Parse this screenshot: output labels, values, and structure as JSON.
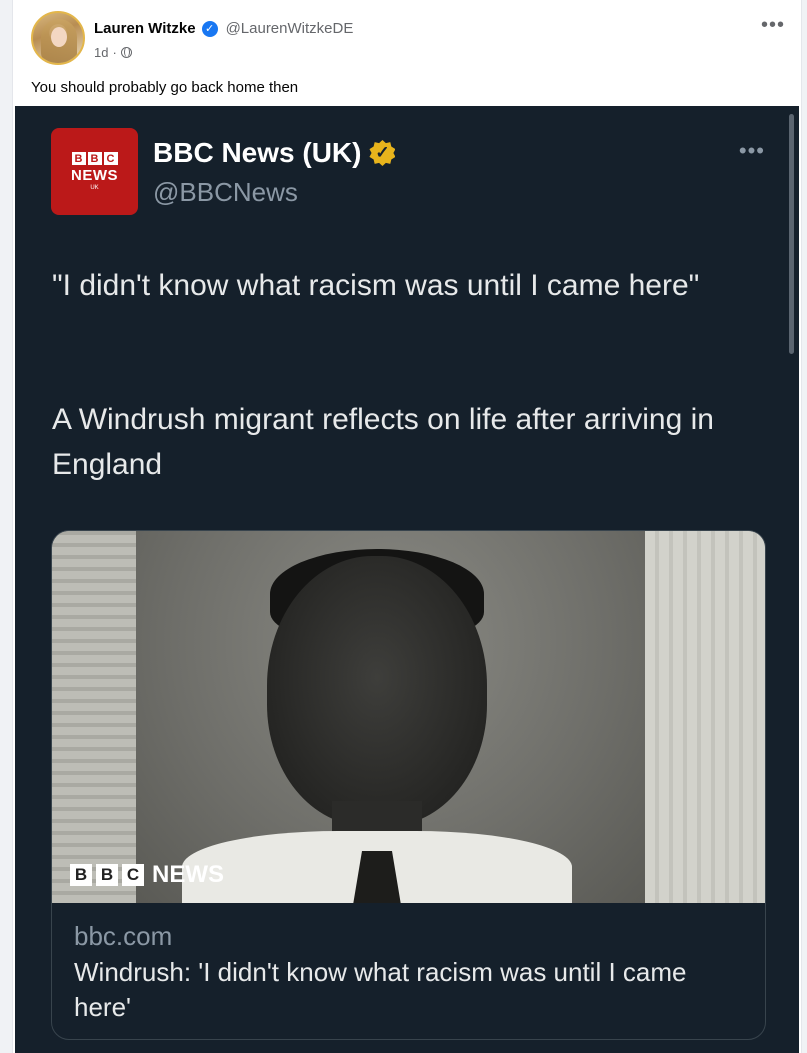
{
  "post": {
    "author_name": "Lauren Witzke",
    "author_handle": "@LaurenWitzkeDE",
    "time": "1d",
    "separator": "·",
    "caption": "You should probably go back home then",
    "more_icon": "•••",
    "verified_icon": "✓",
    "avatar_icon": "avatar"
  },
  "tweet": {
    "logo_letters": [
      "B",
      "B",
      "C"
    ],
    "logo_news": "NEWS",
    "logo_uk": "UK",
    "display_name": "BBC News (UK)",
    "gold_check_icon": "✓",
    "handle": "@BBCNews",
    "more_icon": "•••",
    "text_p1": "\"I didn't know what racism was until I came here\"",
    "text_p2": "A Windrush migrant reflects on life after arriving in England",
    "card": {
      "watermark_letters": [
        "B",
        "B",
        "C"
      ],
      "watermark_news": "NEWS",
      "domain": "bbc.com",
      "title": "Windrush: 'I didn't know what racism was until I came here'"
    }
  },
  "colors": {
    "tweet_bg": "#15202b",
    "bbc_red": "#bb1919",
    "verified_blue": "#1877f2",
    "gold_badge": "#e8b41c"
  }
}
